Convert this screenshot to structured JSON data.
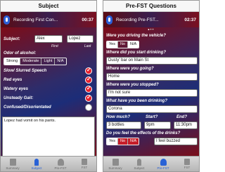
{
  "left": {
    "title": "Subject",
    "recording": {
      "label": "Recording First Con...",
      "time": "00:37"
    },
    "subject_label": "Subject:",
    "first_value": "Alex",
    "last_value": "Lopez",
    "first_sub": "First",
    "last_sub": "Last",
    "odor_label": "Odor of alcohol:",
    "odor_options": [
      "Strong",
      "Moderate",
      "Light",
      "N/A"
    ],
    "odor_selected": "Strong",
    "observations": [
      {
        "label": "Slow/ Slurred Speech",
        "checked": true
      },
      {
        "label": "Red eyes",
        "checked": true
      },
      {
        "label": "Watery eyes",
        "checked": true
      },
      {
        "label": "Unsteady Gait:",
        "checked": true
      },
      {
        "label": "Confused/Disorientated",
        "checked": false
      }
    ],
    "notes": "Lopez had vomit on his pants."
  },
  "right": {
    "title": "Pre-FST Questions",
    "recording": {
      "label": "Recording Pre-FST...",
      "time": "02:37"
    },
    "q_drive": "Were you driving the vehicle?",
    "drive_options": [
      "Yes",
      "No",
      "N/A"
    ],
    "q_start": "Where did you start drinking?",
    "a_start": "Dusty' bar on Main St",
    "q_going": "Where were you going?",
    "a_going": "Home",
    "q_stopped": "Where were you stopped?",
    "a_stopped": "I'm not sure",
    "q_drinking": "What have you been drinking?",
    "a_drinking": "Corona",
    "much_label": "How much?",
    "start_label": "Start?",
    "end_label": "End?",
    "much_value": "3 bottles",
    "start_value": "9pm",
    "end_value": "11:30pm",
    "q_effects": "Do you feel the effects of the drinks?",
    "effects_options": [
      "Yes",
      "No",
      "N/A"
    ],
    "effects_value": "I feel buzzed"
  },
  "tabs": [
    "Summary",
    "Subject",
    "Pre-FST",
    "FST"
  ],
  "left_active_tab": "Subject",
  "right_active_tab": "Pre-FST",
  "colors": {
    "accent": "#2962d6",
    "check": "#e51e2b",
    "background": "#2e2c6a"
  }
}
